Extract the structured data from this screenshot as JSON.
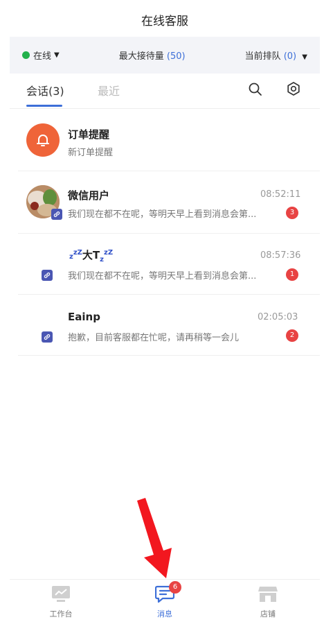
{
  "header": {
    "title": "在线客服"
  },
  "status": {
    "online_label": "在线",
    "max_label": "最大接待量",
    "max_value": "(50)",
    "queue_label": "当前排队",
    "queue_value": "(0)"
  },
  "tabs": {
    "conversations": "会话(3)",
    "recent": "最近"
  },
  "conversations": [
    {
      "name": "订单提醒",
      "preview": "新订单提醒"
    },
    {
      "name": "微信用户",
      "time": "08:52:11",
      "preview": "我们现在都不在呢，等明天早上看到消息会第...",
      "unread": "3"
    },
    {
      "name_parts": [
        "z",
        "z",
        "Z",
        "大T",
        "z",
        "z",
        "Z"
      ],
      "time": "08:57:36",
      "preview": "我们现在都不在呢，等明天早上看到消息会第...",
      "unread": "1"
    },
    {
      "name": "Eainp",
      "time": "02:05:03",
      "preview": "抱歉，目前客服都在忙呢，请再稍等一会儿",
      "unread": "2"
    }
  ],
  "nav": {
    "workbench": "工作台",
    "messages": "消息",
    "messages_badge": "6",
    "store": "店铺"
  },
  "colors": {
    "accent": "#3d6fd8",
    "online": "#22b14c",
    "badge": "#e84343",
    "bell": "#ef6439"
  }
}
